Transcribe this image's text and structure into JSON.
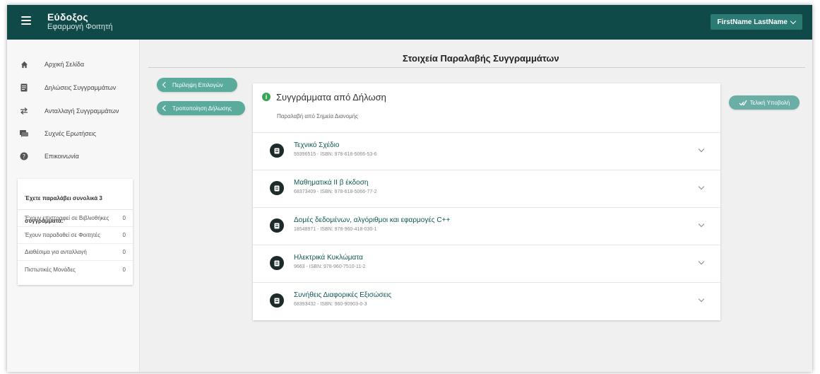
{
  "header": {
    "app_title": "Εύδοξος",
    "app_subtitle": "Εφαρμογή Φοιτητή",
    "user_name": "FirstName LastName"
  },
  "sidebar": {
    "items": [
      {
        "label": "Αρχική Σελίδα",
        "icon": "home-icon"
      },
      {
        "label": "Δηλώσεις Συγγραμμάτων",
        "icon": "document-icon"
      },
      {
        "label": "Ανταλλαγή Συγγραμμάτων",
        "icon": "swap-icon"
      },
      {
        "label": "Συχνές Ερωτήσεις",
        "icon": "chat-icon"
      },
      {
        "label": "Επικοινωνία",
        "icon": "help-icon"
      }
    ],
    "summary": {
      "title": "Έχετε παραλάβει συνολικά 3 συγγράμματα:",
      "rows": [
        {
          "label": "Έχουν επιστραφεί σε Βιβλιοθήκες",
          "value": "0"
        },
        {
          "label": "Έχουν παραδοθεί σε Φοιτητές",
          "value": "0"
        },
        {
          "label": "Διαθέσιμα για ανταλλαγή",
          "value": "0"
        },
        {
          "label": "Πιστωτικές Μονάδες",
          "value": "0"
        }
      ]
    }
  },
  "main": {
    "page_title": "Στοιχεία Παραλαβής Συγγραμμάτων",
    "buttons": {
      "summary": "Περίληψη Επιλογών",
      "modify": "Τροποποίηση Δήλωσης",
      "submit": "Τελική Υποβολή"
    },
    "panel": {
      "title": "Συγγράμματα από Δήλωση",
      "subtitle": "Παραλαβή από Σημεία Διανομής",
      "books": [
        {
          "title": "Τεχνικό Σχέδιο",
          "meta": "59396515 - ISBN: 978-618-5066-53-6"
        },
        {
          "title": "Μαθηματικά ΙΙ β έκδοση",
          "meta": "68373409 - ISBN: 978-618-5066-77-2"
        },
        {
          "title": "Δομές δεδομένων, αλγόριθμοι και εφαρμογές C++",
          "meta": "18548971 - ISBN: 978-960-418-030-1"
        },
        {
          "title": "Ηλεκτρικά Κυκλώματα",
          "meta": "9663 - ISBN: 978-960-7510-11-2"
        },
        {
          "title": "Συνήθεις Διαφορικές Εξισώσεις",
          "meta": "68393432 - ISBN: 960-90903-0-3"
        }
      ]
    }
  },
  "colors": {
    "topbar": "#0f4a48",
    "accent": "#5aab9c",
    "user_button": "#2c7a74",
    "book_title": "#0f5754",
    "info_icon": "#3aa35a"
  }
}
